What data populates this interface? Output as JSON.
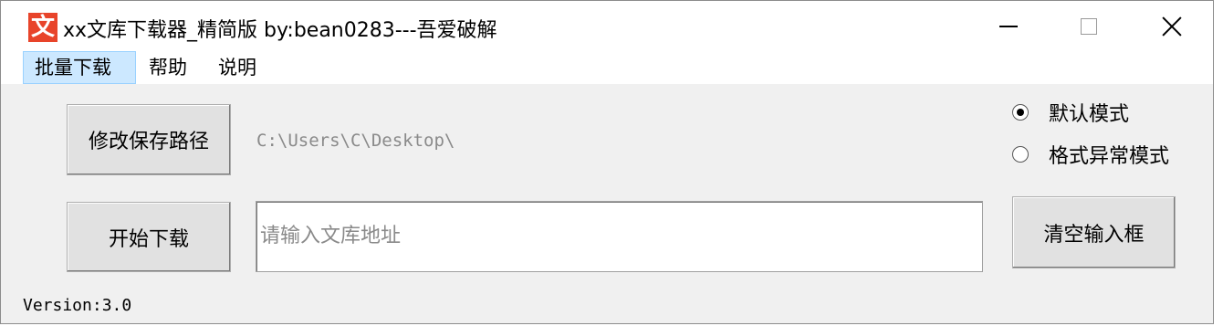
{
  "window": {
    "icon_glyph": "文",
    "title": "xx文库下载器_精简版  by:bean0283---吾爱破解"
  },
  "menu": {
    "items": [
      {
        "label": "批量下载",
        "active": true
      },
      {
        "label": "帮助"
      },
      {
        "label": "说明"
      }
    ]
  },
  "main": {
    "save_path_button": "修改保存路径",
    "save_path_value": "C:\\Users\\C\\Desktop\\",
    "start_button": "开始下载",
    "url_input": {
      "value": "",
      "placeholder": "请输入文库地址"
    },
    "clear_button": "清空输入框",
    "modes": [
      {
        "label": "默认模式",
        "checked": true
      },
      {
        "label": "格式异常模式",
        "checked": false
      }
    ],
    "version": "Version:3.0"
  },
  "colors": {
    "icon_bg": "#e8442a",
    "menu_active_bg": "#cce8ff",
    "window_bg": "#f0f0f0"
  }
}
